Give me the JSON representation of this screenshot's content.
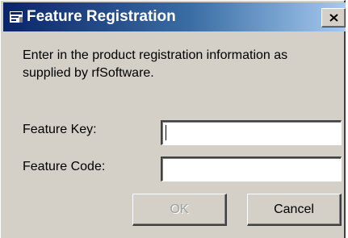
{
  "window": {
    "title": "Feature Registration"
  },
  "dialog": {
    "message": "Enter in the product registration information as supplied by rfSoftware.",
    "feature_key": {
      "label": "Feature Key:",
      "value": ""
    },
    "feature_code": {
      "label": "Feature Code:",
      "value": ""
    },
    "ok_label": "OK",
    "ok_enabled": false,
    "cancel_label": "Cancel"
  },
  "icons": {
    "title_icon": "application-icon",
    "close_icon": "close-icon"
  },
  "colors": {
    "titlebar_start": "#0a246a",
    "titlebar_end": "#a6caf0",
    "face": "#d4d0c8",
    "disabled_text": "#a0a0a0"
  }
}
